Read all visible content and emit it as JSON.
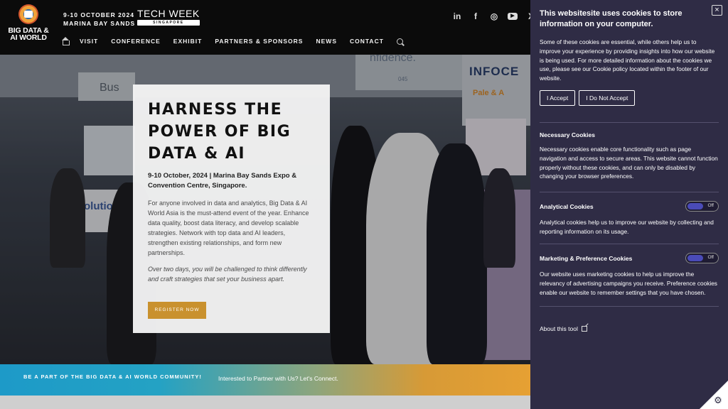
{
  "header": {
    "logo_text": "BIG DATA & AI WORLD",
    "event_dates": "9-10 OCTOBER 2024",
    "event_venue": "MARINA BAY SANDS",
    "techweek_title": "TECH WEEK",
    "techweek_sub": "SINGAPORE",
    "nav": [
      "VISIT",
      "CONFERENCE",
      "EXHIBIT",
      "PARTNERS & SPONSORS",
      "NEWS",
      "CONTACT"
    ],
    "social": [
      "linkedin",
      "facebook",
      "instagram",
      "youtube",
      "x"
    ]
  },
  "hero": {
    "title": "HARNESS THE POWER OF BIG DATA & AI",
    "date_venue": "9-10 October, 2024 | Marina Bay Sands Expo & Convention Centre, Singapore.",
    "description": "For anyone involved in data and analytics, Big Data & AI World Asia is the must-attend event of the year. Enhance data quality, boost data literacy, and develop scalable strategies. Network with top data and AI leaders, strengthen existing relationships, and form new partnerships.",
    "italic_text": "Over two days, you will be challenged to think differently and craft strategies that set your business apart.",
    "register_label": "REGISTER NOW",
    "bg_signs": [
      "Bus",
      "olution",
      "nfidence.",
      "INFOCE",
      "Pale & A",
      "045"
    ]
  },
  "band": {
    "left_text": "BE A PART OF THE BIG DATA & AI WORLD COMMUNITY!",
    "right_text": "Interested to Partner with Us? Let's Connect."
  },
  "cookie": {
    "title": "This websitesite uses cookies to store information on your computer.",
    "intro": "Some of these cookies are essential, while others help us to improve your experience by providing insights into how our website is being used. For more detailed information about the cookies we use, please see our Cookie policy located within the footer of our website.",
    "accept_label": "I Accept",
    "decline_label": "I Do Not Accept",
    "close_symbol": "×",
    "sections": [
      {
        "title": "Necessary Cookies",
        "text": "Necessary cookies enable core functionality such as page navigation and access to secure areas. This website cannot function properly without these cookies, and can only be disabled by changing your browser preferences."
      },
      {
        "title": "Analytical Cookies",
        "toggle": "Off",
        "text": "Analytical cookies help us to improve our website by collecting and reporting information on its usage."
      },
      {
        "title": "Marketing & Preference Cookies",
        "toggle": "Off",
        "text": "Our website uses marketing cookies to help us improve the relevancy of advertising campaigns you receive. Preference cookies enable our website to remember settings that you have chosen."
      }
    ],
    "about_label": "About this tool"
  },
  "colors": {
    "panel_bg": "#2f2c45",
    "register_btn": "#c9912e",
    "band_start": "#1d9ac8",
    "band_end": "#e6a033",
    "toggle_knob": "#4a4bb8"
  }
}
